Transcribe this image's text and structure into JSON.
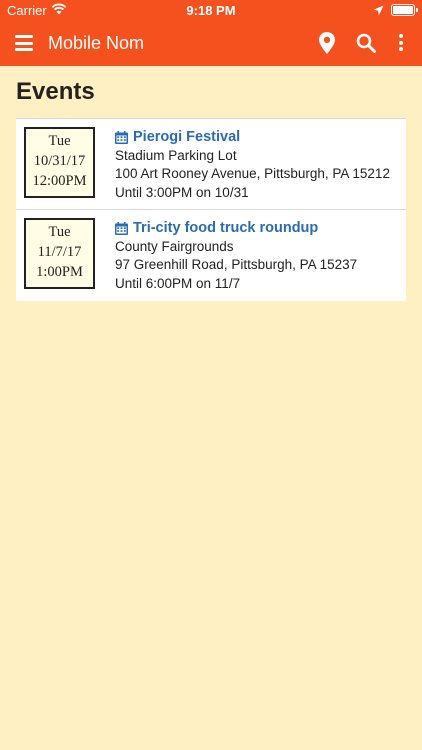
{
  "status_bar": {
    "carrier": "Carrier",
    "time": "9:18 PM"
  },
  "app_bar": {
    "title": "Mobile Nom",
    "icons": [
      "menu-icon",
      "map-marker-icon",
      "search-icon",
      "more-vertical-icon"
    ]
  },
  "page": {
    "title": "Events"
  },
  "events": [
    {
      "date_day": "Tue",
      "date": "10/31/17",
      "time": "12:00PM",
      "title": "Pierogi Festival",
      "venue": "Stadium Parking Lot",
      "address": "100 Art Rooney Avenue, Pittsburgh, PA 15212",
      "until": "Until 3:00PM on 10/31"
    },
    {
      "date_day": "Tue",
      "date": "11/7/17",
      "time": "1:00PM",
      "title": "Tri-city food truck roundup",
      "venue": "County Fairgrounds",
      "address": "97 Greenhill Road, Pittsburgh, PA 15237",
      "until": "Until 6:00PM on 11/7"
    }
  ],
  "colors": {
    "brand": "#f4511e",
    "background": "#fff0c4",
    "link": "#2b6cb0"
  }
}
